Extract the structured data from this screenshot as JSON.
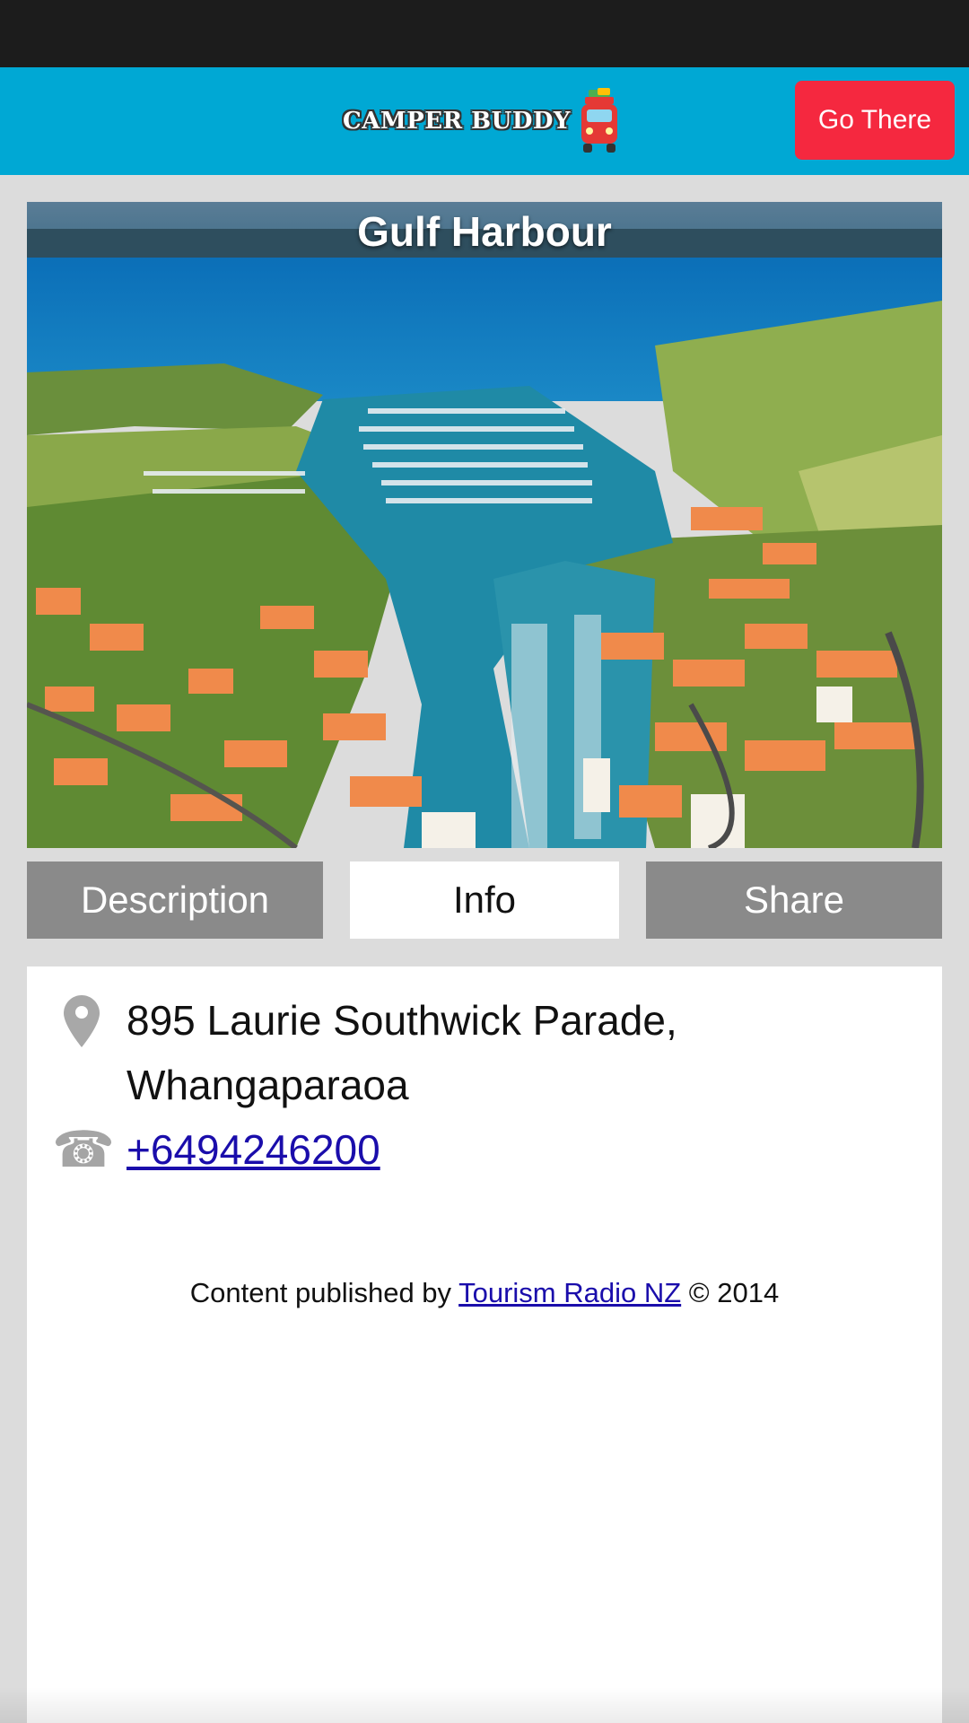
{
  "header": {
    "logo_text": "CAMPER BUDDY",
    "go_there_label": "Go There",
    "brand_color": "#00a8d4",
    "button_color": "#f5283f"
  },
  "hero": {
    "title": "Gulf Harbour"
  },
  "tabs": [
    {
      "label": "Description",
      "active": false
    },
    {
      "label": "Info",
      "active": true
    },
    {
      "label": "Share",
      "active": false
    }
  ],
  "info": {
    "address_line1": "895 Laurie Southwick Parade,",
    "address_line2": "Whangaparaoa",
    "phone": "+6494246200",
    "address_icon": "map-pin-icon",
    "phone_icon": "telephone-icon"
  },
  "credits": {
    "prefix": "Content published by ",
    "publisher": "Tourism Radio NZ",
    "suffix": " © 2014"
  }
}
